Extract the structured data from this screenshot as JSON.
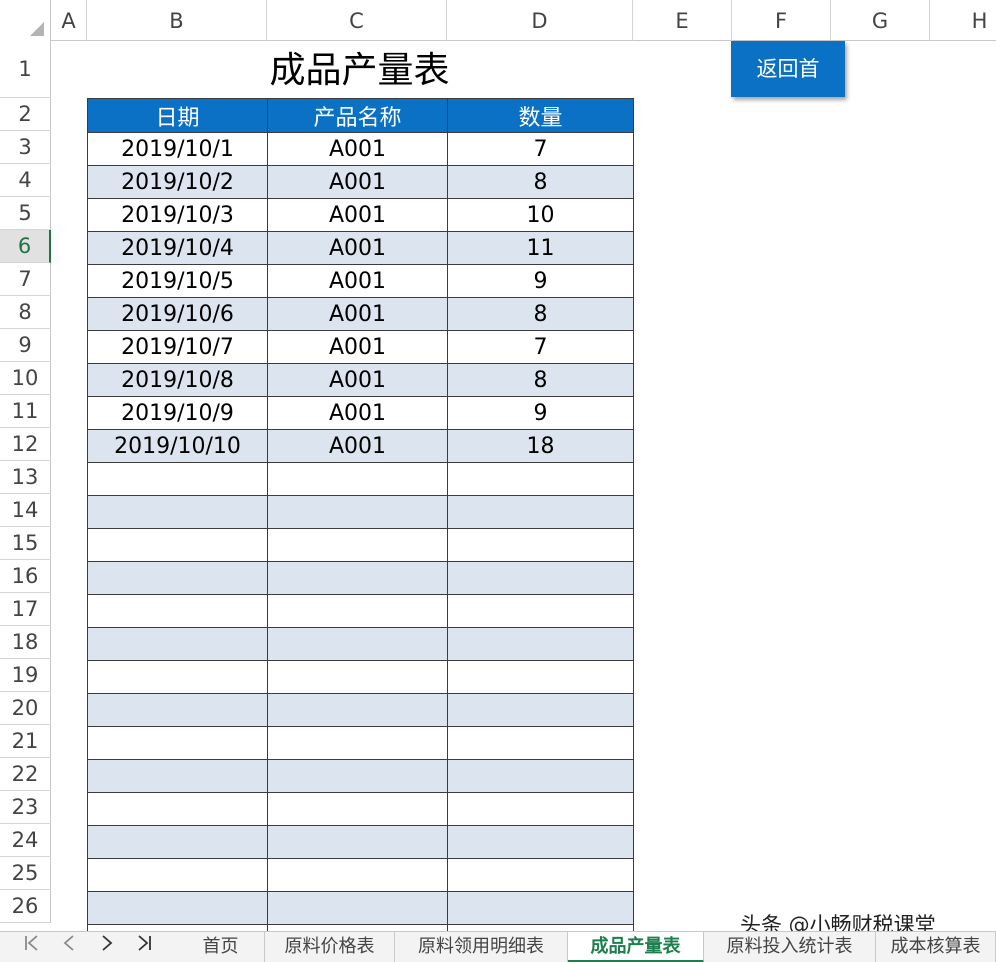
{
  "columns": [
    "A",
    "B",
    "C",
    "D",
    "E",
    "F",
    "G",
    "H"
  ],
  "rows": [
    "1",
    "2",
    "3",
    "4",
    "5",
    "6",
    "7",
    "8",
    "9",
    "10",
    "11",
    "12",
    "13",
    "14",
    "15",
    "16",
    "17",
    "18",
    "19",
    "20",
    "21",
    "22",
    "23",
    "24",
    "25",
    "26"
  ],
  "active_row": "6",
  "sheet": {
    "title": "成品产量表",
    "return_button": "返回首",
    "table": {
      "headers": [
        "日期",
        "产品名称",
        "数量"
      ],
      "rows": [
        [
          "2019/10/1",
          "A001",
          "7"
        ],
        [
          "2019/10/2",
          "A001",
          "8"
        ],
        [
          "2019/10/3",
          "A001",
          "10"
        ],
        [
          "2019/10/4",
          "A001",
          "11"
        ],
        [
          "2019/10/5",
          "A001",
          "9"
        ],
        [
          "2019/10/6",
          "A001",
          "8"
        ],
        [
          "2019/10/7",
          "A001",
          "7"
        ],
        [
          "2019/10/8",
          "A001",
          "8"
        ],
        [
          "2019/10/9",
          "A001",
          "9"
        ],
        [
          "2019/10/10",
          "A001",
          "18"
        ],
        [
          "",
          "",
          ""
        ],
        [
          "",
          "",
          ""
        ],
        [
          "",
          "",
          ""
        ],
        [
          "",
          "",
          ""
        ],
        [
          "",
          "",
          ""
        ],
        [
          "",
          "",
          ""
        ],
        [
          "",
          "",
          ""
        ],
        [
          "",
          "",
          ""
        ],
        [
          "",
          "",
          ""
        ],
        [
          "",
          "",
          ""
        ],
        [
          "",
          "",
          ""
        ],
        [
          "",
          "",
          ""
        ],
        [
          "",
          "",
          ""
        ],
        [
          "",
          "",
          ""
        ],
        [
          "",
          "",
          ""
        ]
      ]
    }
  },
  "tabbar": {
    "nav": {
      "first": "|<",
      "prev": "<",
      "next": ">",
      "last": ">|"
    },
    "tabs": [
      {
        "label": "首页",
        "active": false
      },
      {
        "label": "原料价格表",
        "active": false
      },
      {
        "label": "原料领用明细表",
        "active": false
      },
      {
        "label": "成品产量表",
        "active": true
      },
      {
        "label": "原料投入统计表",
        "active": false
      },
      {
        "label": "成本核算表",
        "active": false
      }
    ]
  },
  "watermark": "头条 @小畅财税课堂",
  "colors": {
    "header_blue": "#0b71c4",
    "alt_row": "#dce5ef",
    "active_tab_green": "#1e7f4e"
  }
}
